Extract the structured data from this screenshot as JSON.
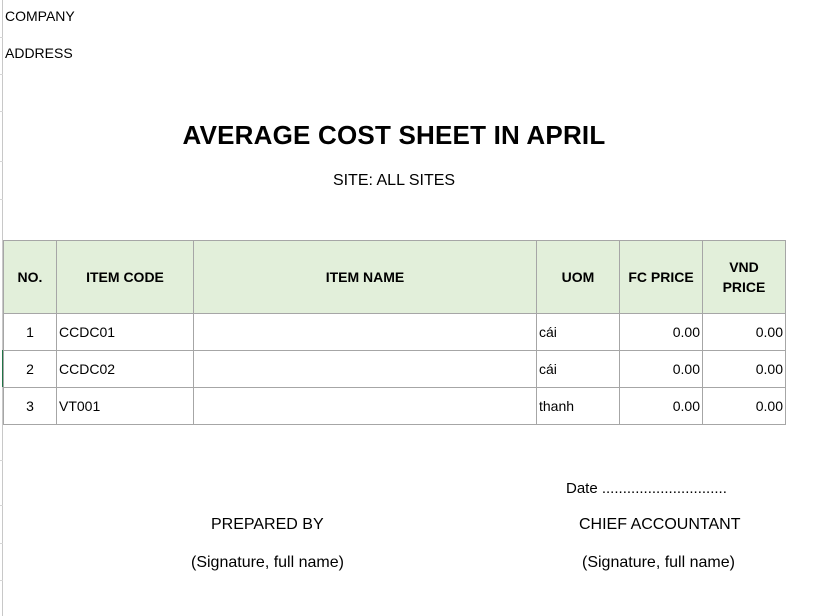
{
  "header": {
    "company_label": "COMPANY",
    "address_label": "ADDRESS"
  },
  "report": {
    "title": "AVERAGE COST SHEET IN APRIL",
    "site_line": "SITE: ALL SITES"
  },
  "table": {
    "columns": [
      "NO.",
      "ITEM CODE",
      "ITEM NAME",
      "UOM",
      "FC PRICE",
      "VND PRICE"
    ],
    "rows": [
      [
        "1",
        "CCDC01",
        "",
        "cái",
        "0.00",
        "0.00"
      ],
      [
        "2",
        "CCDC02",
        "",
        "cái",
        "0.00",
        "0.00"
      ],
      [
        "3",
        "VT001",
        "",
        "thanh",
        "0.00",
        "0.00"
      ]
    ]
  },
  "footer": {
    "date_line": "Date ..............................",
    "prepared_by": "PREPARED BY",
    "chief_accountant": "CHIEF ACCOUNTANT",
    "signature_left": "(Signature, full name)",
    "signature_right": "(Signature, full name)"
  },
  "colors": {
    "header_fill": "#e2efda",
    "grid_border": "#a6a6a6",
    "active_cell_accent": "#217346"
  }
}
